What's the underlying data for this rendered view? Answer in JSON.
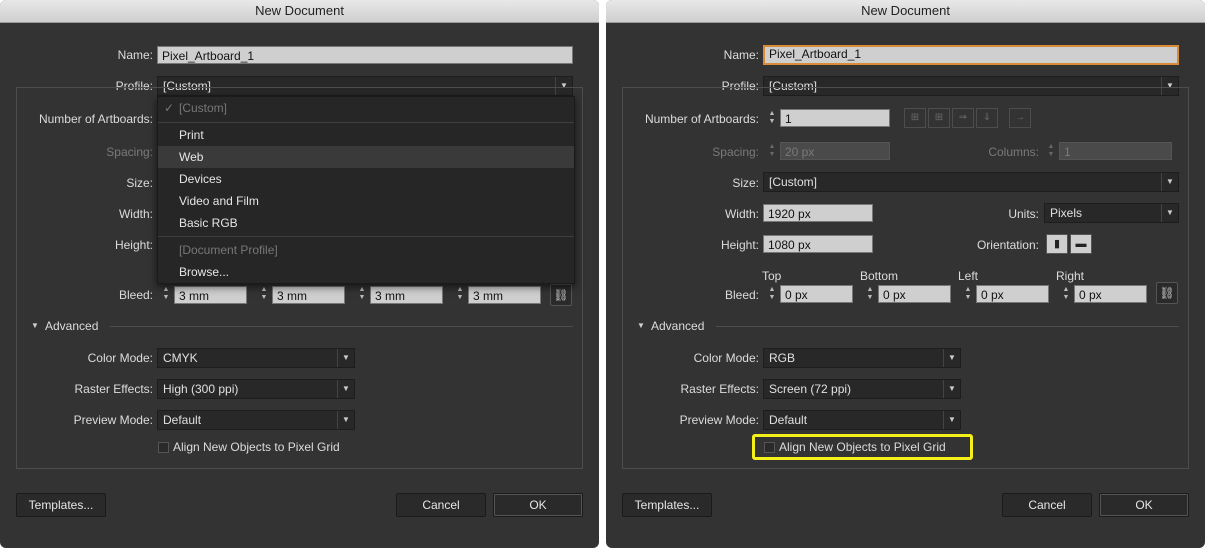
{
  "left": {
    "title": "New Document",
    "name_label": "Name:",
    "name_value": "Pixel_Artboard_1",
    "profile_label": "Profile:",
    "profile_value": "[Custom]",
    "artboards_label": "Number of Artboards:",
    "spacing_label": "Spacing:",
    "size_label": "Size:",
    "width_label": "Width:",
    "height_label": "Height:",
    "bleed_label": "Bleed:",
    "bleed_values": [
      "3 mm",
      "3 mm",
      "3 mm",
      "3 mm"
    ],
    "advanced_label": "Advanced",
    "color_mode_label": "Color Mode:",
    "color_mode_value": "CMYK",
    "raster_label": "Raster Effects:",
    "raster_value": "High (300 ppi)",
    "preview_label": "Preview Mode:",
    "preview_value": "Default",
    "align_label": "Align New Objects to Pixel Grid",
    "templates_button": "Templates...",
    "cancel_button": "Cancel",
    "ok_button": "OK",
    "profile_menu": {
      "checked_item": "[Custom]",
      "items": [
        "Print",
        "Web",
        "Devices",
        "Video and Film",
        "Basic RGB"
      ],
      "document_profile": "[Document Profile]",
      "browse": "Browse..."
    }
  },
  "right": {
    "title": "New Document",
    "name_label": "Name:",
    "name_value": "Pixel_Artboard_1",
    "profile_label": "Profile:",
    "profile_value": "[Custom]",
    "artboards_label": "Number of Artboards:",
    "artboards_value": "1",
    "spacing_label": "Spacing:",
    "spacing_value": "20 px",
    "columns_label": "Columns:",
    "columns_value": "1",
    "size_label": "Size:",
    "size_value": "[Custom]",
    "width_label": "Width:",
    "width_value": "1920 px",
    "height_label": "Height:",
    "height_value": "1080 px",
    "units_label": "Units:",
    "units_value": "Pixels",
    "orientation_label": "Orientation:",
    "bleed_label": "Bleed:",
    "bleed_headers": [
      "Top",
      "Bottom",
      "Left",
      "Right"
    ],
    "bleed_values": [
      "0 px",
      "0 px",
      "0 px",
      "0 px"
    ],
    "advanced_label": "Advanced",
    "color_mode_label": "Color Mode:",
    "color_mode_value": "RGB",
    "raster_label": "Raster Effects:",
    "raster_value": "Screen (72 ppi)",
    "preview_label": "Preview Mode:",
    "preview_value": "Default",
    "align_label": "Align New Objects to Pixel Grid",
    "templates_button": "Templates...",
    "cancel_button": "Cancel",
    "ok_button": "OK"
  },
  "colors": {
    "dialog_bg": "#333333",
    "highlight": "#f5f01a",
    "focus_ring": "#d98b38"
  },
  "icons": [
    "checkmark-icon",
    "dropdown-arrow-icon",
    "stepper-icon",
    "disclosure-triangle-icon",
    "chain-link-icon",
    "portrait-icon",
    "landscape-icon",
    "arrange-grid-icon",
    "arrow-right-icon"
  ]
}
